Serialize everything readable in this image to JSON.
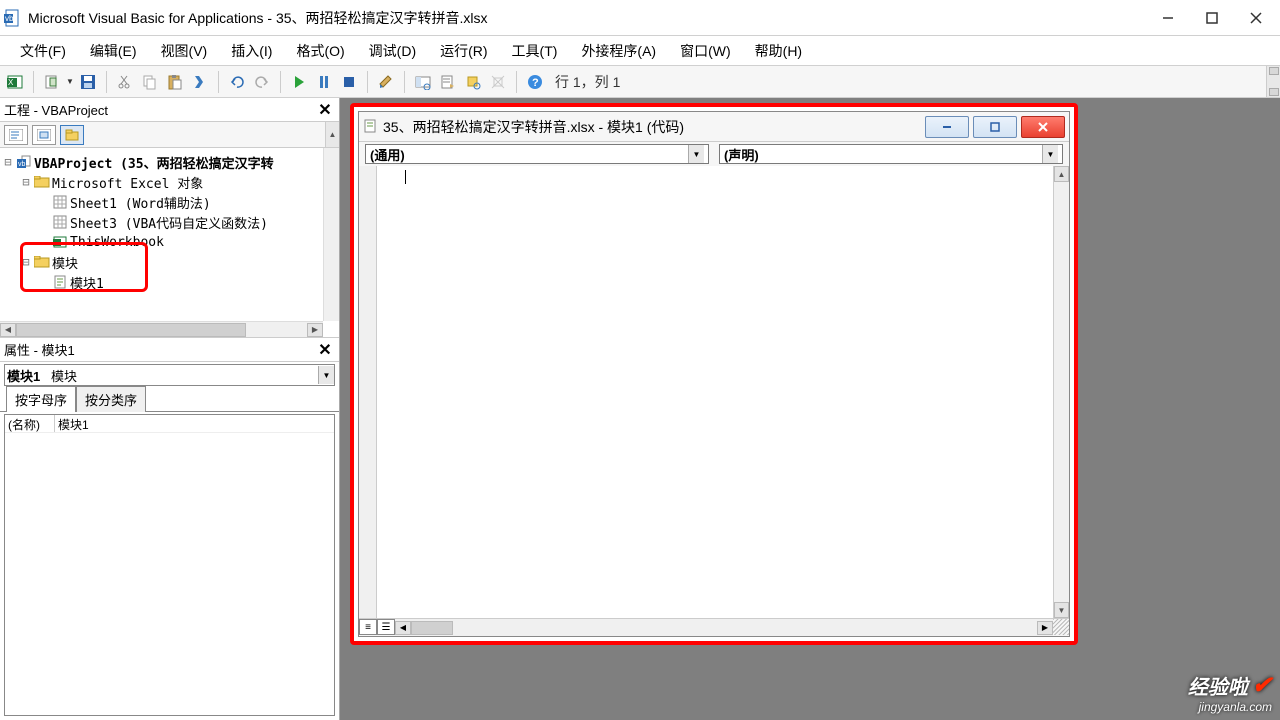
{
  "window": {
    "title": "Microsoft Visual Basic for Applications - 35、两招轻松搞定汉字转拼音.xlsx"
  },
  "menu": {
    "items": [
      "文件(F)",
      "编辑(E)",
      "视图(V)",
      "插入(I)",
      "格式(O)",
      "调试(D)",
      "运行(R)",
      "工具(T)",
      "外接程序(A)",
      "窗口(W)",
      "帮助(H)"
    ]
  },
  "toolbar": {
    "position_label": "行 1，列 1"
  },
  "project_pane": {
    "title": "工程 - VBAProject",
    "tree": {
      "root": "VBAProject (35、两招轻松搞定汉字转",
      "excel_folder": "Microsoft Excel 对象",
      "sheet1": "Sheet1 (Word辅助法)",
      "sheet3": "Sheet3 (VBA代码自定义函数法)",
      "thiswb": "ThisWorkbook",
      "modules_folder": "模块",
      "module1": "模块1"
    }
  },
  "props_pane": {
    "title": "属性 - 模块1",
    "combo_name": "模块1",
    "combo_type": "模块",
    "tab_alpha": "按字母序",
    "tab_cat": "按分类序",
    "row_name_label": "(名称)",
    "row_name_value": "模块1"
  },
  "code_window": {
    "title": "35、两招轻松搞定汉字转拼音.xlsx - 模块1 (代码)",
    "combo_left": "(通用)",
    "combo_right": "(声明)"
  },
  "watermark": {
    "line1": "经验啦",
    "line2": "jingyanla.com"
  }
}
